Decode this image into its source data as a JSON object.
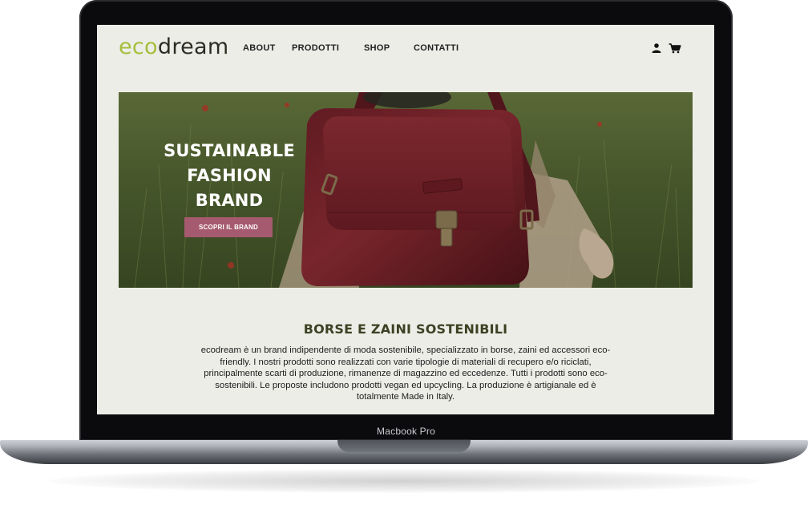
{
  "device": {
    "label": "Macbook Pro"
  },
  "site": {
    "logo": {
      "part1": "eco",
      "part2": "dream"
    },
    "nav": {
      "items": [
        {
          "label": "ABOUT"
        },
        {
          "label": "PRODOTTI"
        },
        {
          "label": "SHOP"
        },
        {
          "label": "CONTATTI"
        }
      ],
      "icons": [
        "user-icon",
        "cart-icon"
      ]
    },
    "hero": {
      "title_lines": [
        "SUSTAINABLE",
        "FASHION",
        "BRAND"
      ],
      "cta_label": "SCOPRI IL BRAND"
    },
    "section": {
      "title": "BORSE E ZAINI SOSTENIBILI",
      "body": "ecodream è un brand indipendente di moda sostenibile, specializzato in borse, zaini ed accessori eco-friendly. I nostri prodotti sono realizzati con varie tipologie di materiali di recupero e/o riciclati, principalmente scarti di produzione, rimanenze di magazzino ed eccedenze. Tutti i prodotti sono eco-sostenibili. Le proposte includono prodotti vegan ed upcycling. La produzione è artigianale ed è totalmente Made in Italy."
    }
  },
  "colors": {
    "logo_eco": "#a5bf3b",
    "logo_dream": "#2c2c22",
    "page_bg": "#ecede7",
    "cta_bg": "#a65a70",
    "section_title": "#3b4223"
  }
}
